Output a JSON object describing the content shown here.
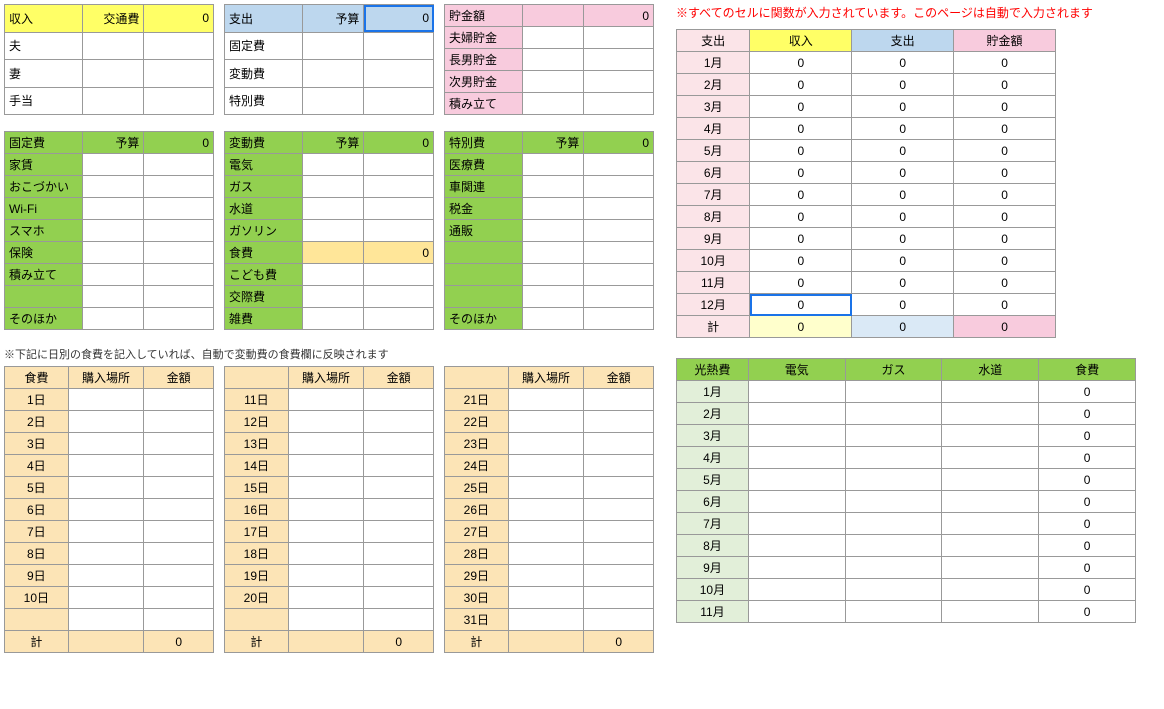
{
  "income": {
    "title": "収入",
    "sub_label": "交通費",
    "sub_value": "0",
    "rows": [
      "夫",
      "妻",
      "手当"
    ]
  },
  "expense": {
    "title": "支出",
    "budget_label": "予算",
    "budget_value": "0",
    "rows": [
      "固定費",
      "変動費",
      "特別費"
    ]
  },
  "savings": {
    "title": "貯金額",
    "value": "0",
    "rows": [
      "夫婦貯金",
      "長男貯金",
      "次男貯金",
      "積み立て"
    ]
  },
  "fixed": {
    "title": "固定費",
    "budget_label": "予算",
    "budget_value": "0",
    "rows": [
      "家賃",
      "おこづかい",
      "Wi-Fi",
      "スマホ",
      "保険",
      "積み立て",
      "",
      "そのほか"
    ]
  },
  "variable": {
    "title": "変動費",
    "budget_label": "予算",
    "budget_value": "0",
    "rows": [
      "電気",
      "ガス",
      "水道",
      "ガソリン",
      "食費",
      "こども費",
      "交際費",
      "雑費"
    ],
    "food_value": "0"
  },
  "special": {
    "title": "特別費",
    "budget_label": "予算",
    "budget_value": "0",
    "rows": [
      "医療費",
      "車関連",
      "税金",
      "通販",
      "",
      "",
      "",
      "そのほか"
    ]
  },
  "daily_note": "※下記に日別の食費を記入していれば、自動で変動費の食費欄に反映されます",
  "daily": {
    "h1": "食費",
    "h2": "購入場所",
    "h3": "金額",
    "total_label": "計",
    "total_value": "0",
    "col1": [
      "1日",
      "2日",
      "3日",
      "4日",
      "5日",
      "6日",
      "7日",
      "8日",
      "9日",
      "10日"
    ],
    "col2": [
      "11日",
      "12日",
      "13日",
      "14日",
      "15日",
      "16日",
      "17日",
      "18日",
      "19日",
      "20日"
    ],
    "col3": [
      "21日",
      "22日",
      "23日",
      "24日",
      "25日",
      "26日",
      "27日",
      "28日",
      "29日",
      "30日",
      "31日"
    ]
  },
  "right_note": "※すべてのセルに関数が入力されています。このページは自動で入力されます",
  "summary": {
    "h0": "支出",
    "h1": "収入",
    "h2": "支出",
    "h3": "貯金額",
    "months": [
      "1月",
      "2月",
      "3月",
      "4月",
      "5月",
      "6月",
      "7月",
      "8月",
      "9月",
      "10月",
      "11月",
      "12月"
    ],
    "total_label": "計",
    "zero": "0"
  },
  "util": {
    "h0": "光熱費",
    "h1": "電気",
    "h2": "ガス",
    "h3": "水道",
    "h4": "食費",
    "months": [
      "1月",
      "2月",
      "3月",
      "4月",
      "5月",
      "6月",
      "7月",
      "8月",
      "9月",
      "10月",
      "11月"
    ],
    "zero": "0"
  }
}
